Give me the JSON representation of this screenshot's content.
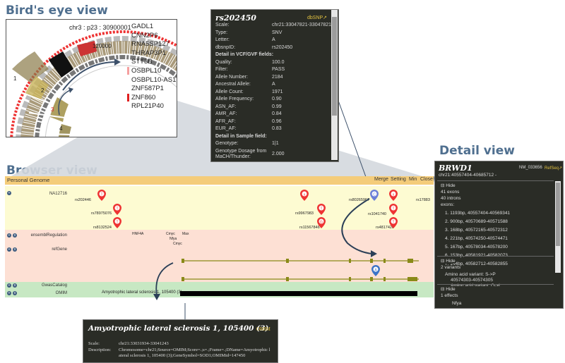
{
  "titles": {
    "birds_eye": "Bird's eye view",
    "browser": "Browser view",
    "detail": "Detail view"
  },
  "birds_eye": {
    "location": "chr3 : p23 : 30900001",
    "scale_label": "120000",
    "chromosome_numbers": [
      "1",
      "2",
      "3",
      "4"
    ],
    "genes": [
      {
        "name": "GADL1",
        "mark": ""
      },
      {
        "name": "CNN2P6",
        "mark": ""
      },
      {
        "name": "RNA5SP127",
        "mark": ""
      },
      {
        "name": "THRAP3P1",
        "mark": ""
      },
      {
        "name": "STT3B",
        "mark": ""
      },
      {
        "name": "OSBPL10",
        "mark": "#f5a0a0"
      },
      {
        "name": "OSBPL10-AS1",
        "mark": ""
      },
      {
        "name": "ZNF587P1",
        "mark": ""
      },
      {
        "name": "ZNF860",
        "mark": "#e02020"
      },
      {
        "name": "RPL21P40",
        "mark": ""
      }
    ]
  },
  "snp_popup": {
    "title": "rs202450",
    "link": "dbSNP↗",
    "rows": [
      {
        "k": "Scale:",
        "v": "chr21:33047821-33047821"
      },
      {
        "k": "Type:",
        "v": "SNV"
      },
      {
        "k": "Letter:",
        "v": "A"
      },
      {
        "k": "dbsnpID:",
        "v": "rs202450"
      },
      {
        "k": "Detail in VCF/GVF fields:",
        "v": "",
        "bold": true
      },
      {
        "k": "Quality:",
        "v": "100.0"
      },
      {
        "k": "Filter:",
        "v": "PASS"
      },
      {
        "k": "Allele Number:",
        "v": "2184"
      },
      {
        "k": "Ancestral Allele:",
        "v": "A"
      },
      {
        "k": "Allele Count:",
        "v": "1971"
      },
      {
        "k": "Allele Frequency:",
        "v": "0.90"
      },
      {
        "k": "ASN_AF:",
        "v": "0.99"
      },
      {
        "k": "AMR_AF:",
        "v": "0.84"
      },
      {
        "k": "AFR_AF:",
        "v": "0.96"
      },
      {
        "k": "EUR_AF:",
        "v": "0.83"
      },
      {
        "k": "Detail in Sample field:",
        "v": "",
        "bold": true
      },
      {
        "k": "Genotype:",
        "v": "1|1"
      },
      {
        "k": "Genotype Dosage from MaCH/Thunder:",
        "v": "2.000"
      }
    ]
  },
  "browser": {
    "header_title": "Personal Genome",
    "header_buttons": [
      "Merge",
      "Setting",
      "Min",
      "Close"
    ],
    "tracks": [
      "NA12716",
      "ensemblRegulation",
      "refGene",
      "GwasCatalog",
      "OMIM"
    ],
    "snps": [
      "rs202446",
      "rs78975076",
      "rs8132524",
      "rs9967983",
      "rs11567846",
      "rs80265967",
      "rs1041740",
      "rs4817420",
      "rs17883"
    ],
    "regulation": [
      "HNF4A",
      "Cmyc",
      "Max",
      "Nfya",
      "Cmyc"
    ],
    "omim_label": "Amyotrophic lateral sclerosis 1, 105400 (3)"
  },
  "detail": {
    "title": "BRWD1",
    "id": "NM_033656",
    "link": "RefSeq↗",
    "location": "chr21:40557404-40685712 -",
    "hide": "Hide",
    "exons_count": "41 exons",
    "introns_count": "40 introns",
    "exons_label": "exons:",
    "exons": [
      "1. 1193bp, 40557404-40569341",
      "2. 900bp, 40570689-40571588",
      "3. 168bp, 40572165-40572312",
      "4. 221bp, 40574250-40574471",
      "5. 167bp, 40578034-40578200",
      "6. 153bp, 40581921-40582073",
      "7. 144bp, 40582712-40582855"
    ],
    "variants_count": "2 variants",
    "variant_1": "Amino acid variant: S->P",
    "variant_1_loc": "40574303-40574305",
    "variant_2": "Amino acid variant: Q->L",
    "effects_count": "1 effects",
    "effect_1": "Nfya"
  },
  "omim_popup": {
    "title": "Amyotrophic lateral sclerosis 1, 105400 (3)",
    "link": "OMIM",
    "scale_label": "Scale:",
    "scale": "chr21:33031934-33041243",
    "desc_label": "Description:",
    "desc_1": "Chromosome=chr21;Source=OMIM;Score=.;s=.;Frame=.;DName=Amyotrophic l",
    "desc_2": "ateral sclerosis 1, 105400 (3);GeneSymbol=SOD1;OMIMid=147450"
  }
}
